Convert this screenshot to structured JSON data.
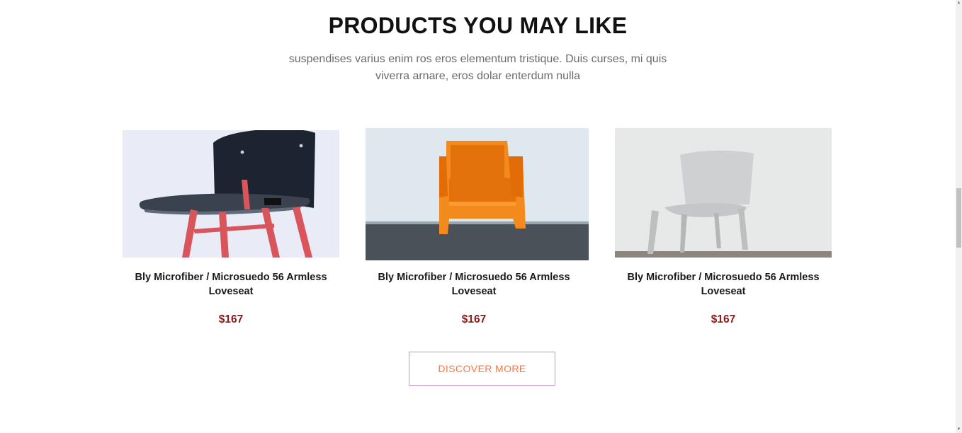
{
  "section": {
    "title": "PRODUCTS YOU MAY LIKE",
    "subtitle": "suspendises varius enim ros eros elementum tristique. Duis curses, mi quis viverra arnare, eros dolar enterdum nulla"
  },
  "products": [
    {
      "name": "Bly Microfiber / Microsuedo 56 Armless Loveseat",
      "price": "$167",
      "image": "black-chair-red-legs"
    },
    {
      "name": "Bly Microfiber / Microsuedo 56 Armless Loveseat",
      "price": "$167",
      "image": "orange-armchair"
    },
    {
      "name": "Bly Microfiber / Microsuedo 56 Armless Loveseat",
      "price": "$167",
      "image": "white-plastic-chair"
    }
  ],
  "cta": {
    "label": "DISCOVER MORE"
  },
  "colors": {
    "price": "#8b1a1a",
    "cta_text": "#ee7a4a",
    "cta_border": "#c792c7"
  }
}
